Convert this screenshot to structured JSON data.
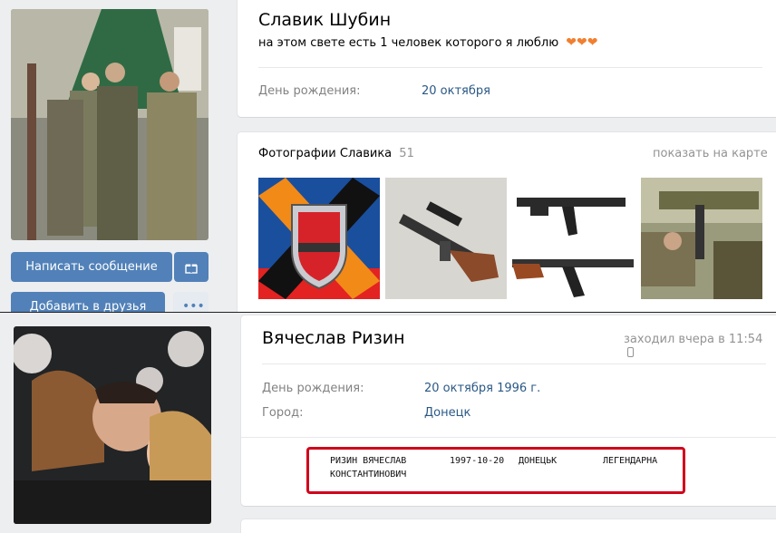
{
  "profile1": {
    "name": "Славик Шубин",
    "status": "на этом свете есть 1 человек которого я люблю",
    "birthday_label": "День рождения:",
    "birthday_value": "20 октября",
    "message_button": "Написать сообщение",
    "add_friend_button": "Добавить в друзья",
    "photos_title": "Фотографии Славика",
    "photos_count": "51",
    "photos_map_link": "показать на карте",
    "photos": [
      {
        "icon": "patriot-emblem"
      },
      {
        "icon": "sniper-rifle"
      },
      {
        "icon": "assault-rifles"
      },
      {
        "icon": "soldiers-launcher"
      }
    ]
  },
  "profile2": {
    "name": "Вячеслав Ризин",
    "last_seen": "заходил вчера в 11:54",
    "birthday_label": "День рождения:",
    "birthday_value": "20 октября 1996 г.",
    "city_label": "Город:",
    "city_value": "Донецк"
  },
  "record": {
    "surname_name": "РИЗИН ВЯЧЕСЛАВ",
    "patronymic": "КОНСТАНТИНОВИЧ",
    "date": "1997-10-20",
    "city": "ДОНЕЦЬК",
    "status": "ЛЕГЕНДАРНА"
  },
  "colors": {
    "link": "#2a5885",
    "button": "#5181b8",
    "highlight": "#d0021b"
  }
}
